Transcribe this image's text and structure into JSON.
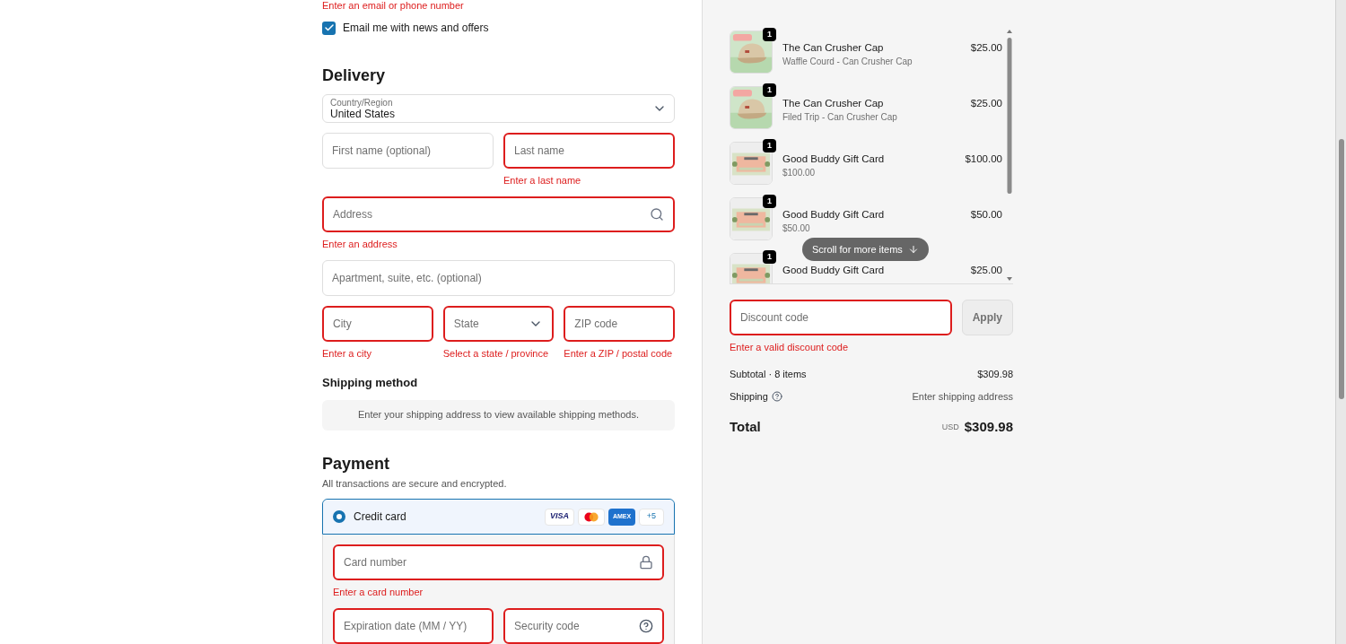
{
  "contact": {
    "error": "Enter an email or phone number",
    "newsletter": {
      "label": "Email me with news and offers",
      "checked": true
    }
  },
  "delivery": {
    "title": "Delivery",
    "country": {
      "label": "Country/Region",
      "value": "United States"
    },
    "rows": [
      [
        {
          "kind": "text",
          "placeholder": "First name (optional)",
          "invalid": false
        },
        {
          "kind": "text",
          "placeholder": "Last name",
          "invalid": true,
          "error": "Enter a last name"
        }
      ],
      [
        {
          "kind": "search",
          "placeholder": "Address",
          "invalid": true,
          "error": "Enter an address"
        }
      ],
      [
        {
          "kind": "text",
          "placeholder": "Apartment, suite, etc. (optional)",
          "invalid": false
        }
      ],
      [
        {
          "kind": "text",
          "placeholder": "City",
          "invalid": true,
          "error": "Enter a city"
        },
        {
          "kind": "select",
          "placeholder": "State",
          "invalid": true,
          "error": "Select a state / province"
        },
        {
          "kind": "text",
          "placeholder": "ZIP code",
          "invalid": true,
          "error": "Enter a ZIP / postal code"
        }
      ]
    ]
  },
  "shipping_method": {
    "title": "Shipping method",
    "message": "Enter your shipping address to view available shipping methods."
  },
  "payment": {
    "title": "Payment",
    "subtitle": "All transactions are secure and encrypted.",
    "option": {
      "label": "Credit card",
      "selected": true,
      "brands": [
        {
          "kind": "visa",
          "label": "VISA"
        },
        {
          "kind": "mastercard"
        },
        {
          "kind": "amex",
          "label": "AMEX"
        }
      ],
      "more": "+5"
    },
    "rows": [
      [
        {
          "kind": "lock",
          "placeholder": "Card number",
          "invalid": true,
          "error": "Enter a card number"
        }
      ],
      [
        {
          "kind": "text",
          "placeholder": "Expiration date (MM / YY)",
          "invalid": true
        },
        {
          "kind": "help",
          "placeholder": "Security code",
          "invalid": true
        }
      ]
    ]
  },
  "summary": {
    "items": [
      {
        "kind": "cap",
        "quantity": "1",
        "title": "The Can Crusher Cap",
        "subtitle": "Waffle Courd - Can Crusher Cap",
        "price": "$25.00"
      },
      {
        "kind": "cap",
        "quantity": "1",
        "title": "The Can Crusher Cap",
        "subtitle": "Filed Trip - Can Crusher Cap",
        "price": "$25.00"
      },
      {
        "kind": "giftcard",
        "quantity": "1",
        "title": "Good Buddy Gift Card",
        "subtitle": "$100.00",
        "price": "$100.00"
      },
      {
        "kind": "giftcard",
        "quantity": "1",
        "title": "Good Buddy Gift Card",
        "subtitle": "$50.00",
        "price": "$50.00"
      },
      {
        "kind": "giftcard",
        "quantity": "1",
        "title": "Good Buddy Gift Card",
        "price": "$25.00"
      }
    ],
    "scroll_hint": "Scroll for more items",
    "discount": {
      "placeholder": "Discount code",
      "invalid": true,
      "error": "Enter a valid discount code",
      "button": "Apply"
    },
    "subtotal": {
      "label": "Subtotal · 8 items",
      "value": "$309.98"
    },
    "shipping": {
      "label": "Shipping",
      "value": "Enter shipping address"
    },
    "total": {
      "label": "Total",
      "currency": "USD",
      "value": "$309.98"
    }
  }
}
